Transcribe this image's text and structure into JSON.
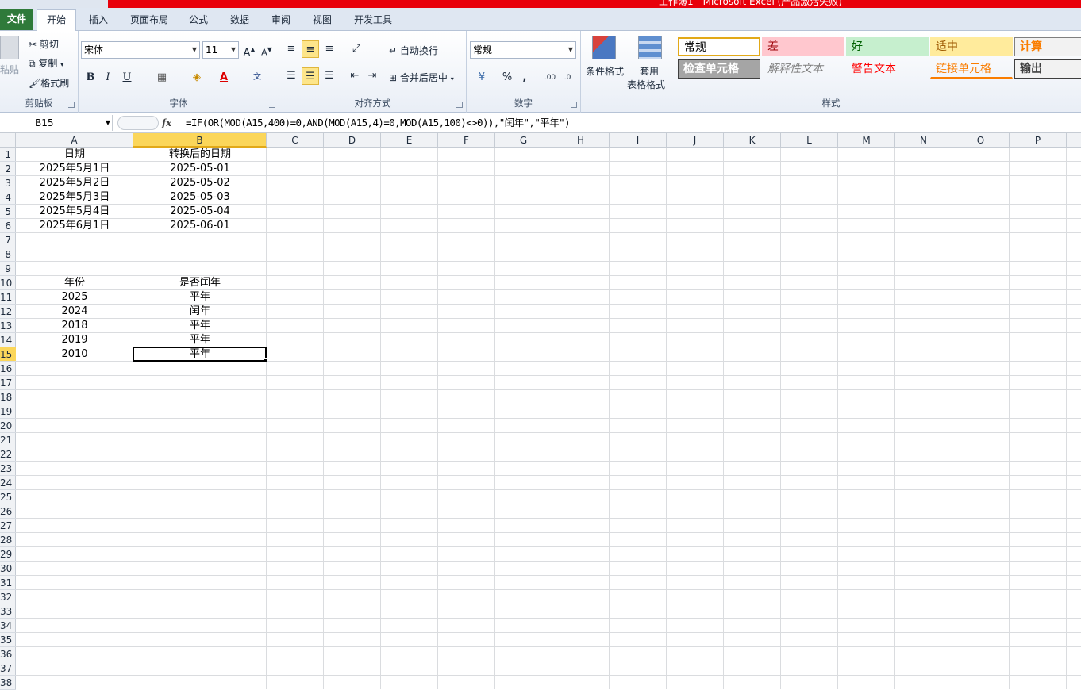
{
  "window": {
    "title": "工作簿1 - Microsoft Excel (产品激活失败)"
  },
  "tabs": [
    "文件",
    "开始",
    "插入",
    "页面布局",
    "公式",
    "数据",
    "审阅",
    "视图",
    "开发工具"
  ],
  "clipboard": {
    "paste": "粘贴",
    "cut": "剪切",
    "copy": "复制",
    "format_painter": "格式刷",
    "group": "剪贴板"
  },
  "font": {
    "name": "宋体",
    "size": "11",
    "bold": "B",
    "italic": "I",
    "underline": "U",
    "group": "字体"
  },
  "alignment": {
    "wrap": "自动换行",
    "merge": "合并后居中",
    "group": "对齐方式"
  },
  "number": {
    "format": "常规",
    "percent": "%",
    "comma": ",",
    "group": "数字"
  },
  "styles": {
    "conditional": "条件格式",
    "table_l1": "套用",
    "table_l2": "表格格式",
    "group": "样式",
    "cells": [
      {
        "label": "常规",
        "bg": "#ffffff",
        "fg": "#000000",
        "border": "#e2a918"
      },
      {
        "label": "差",
        "bg": "#ffc7ce",
        "fg": "#9c0006",
        "border": "transparent"
      },
      {
        "label": "好",
        "bg": "#c6efce",
        "fg": "#006100",
        "border": "transparent"
      },
      {
        "label": "适中",
        "bg": "#ffeb9c",
        "fg": "#9c5700",
        "border": "transparent"
      },
      {
        "label": "计算",
        "bg": "#f2f2f2",
        "fg": "#fa7d00",
        "border": "#7f7f7f"
      },
      {
        "label": "检查单元格",
        "bg": "#a5a5a5",
        "fg": "#ffffff",
        "border": "#3f3f3f"
      },
      {
        "label": "解释性文本",
        "bg": "transparent",
        "fg": "#7f7f7f",
        "border": "transparent"
      },
      {
        "label": "警告文本",
        "bg": "transparent",
        "fg": "#ff0000",
        "border": "transparent"
      },
      {
        "label": "链接单元格",
        "bg": "transparent",
        "fg": "#fa7d00",
        "border": "transparent"
      },
      {
        "label": "输出",
        "bg": "#f2f2f2",
        "fg": "#3f3f3f",
        "border": "#3f3f3f"
      }
    ]
  },
  "formula_bar": {
    "name_box": "B15",
    "fx": "fx",
    "formula": "=IF(OR(MOD(A15,400)=0,AND(MOD(A15,4)=0,MOD(A15,100)<>0)),\"闰年\",\"平年\")"
  },
  "columns": [
    "A",
    "B",
    "C",
    "D",
    "E",
    "F",
    "G",
    "H",
    "I",
    "J",
    "K",
    "L",
    "M",
    "N",
    "O",
    "P"
  ],
  "rows": [
    "1",
    "2",
    "3",
    "4",
    "5",
    "6",
    "7",
    "8",
    "9",
    "10",
    "11",
    "12",
    "13",
    "14",
    "15",
    "16",
    "17",
    "18",
    "19",
    "20",
    "21",
    "22",
    "23",
    "24",
    "25",
    "26",
    "27",
    "28",
    "29",
    "30",
    "31",
    "32",
    "33",
    "34",
    "35",
    "36",
    "37",
    "38"
  ],
  "cells": [
    {
      "ref": "A1",
      "value": "日期"
    },
    {
      "ref": "B1",
      "value": "转换后的日期"
    },
    {
      "ref": "A2",
      "value": "2025年5月1日"
    },
    {
      "ref": "B2",
      "value": "2025-05-01"
    },
    {
      "ref": "A3",
      "value": "2025年5月2日"
    },
    {
      "ref": "B3",
      "value": "2025-05-02"
    },
    {
      "ref": "A4",
      "value": "2025年5月3日"
    },
    {
      "ref": "B4",
      "value": "2025-05-03"
    },
    {
      "ref": "A5",
      "value": "2025年5月4日"
    },
    {
      "ref": "B5",
      "value": "2025-05-04"
    },
    {
      "ref": "A6",
      "value": "2025年6月1日"
    },
    {
      "ref": "B6",
      "value": "2025-06-01"
    },
    {
      "ref": "A10",
      "value": "年份"
    },
    {
      "ref": "B10",
      "value": "是否闰年"
    },
    {
      "ref": "A11",
      "value": "2025"
    },
    {
      "ref": "B11",
      "value": "平年"
    },
    {
      "ref": "A12",
      "value": "2024"
    },
    {
      "ref": "B12",
      "value": "闰年"
    },
    {
      "ref": "A13",
      "value": "2018"
    },
    {
      "ref": "B13",
      "value": "平年"
    },
    {
      "ref": "A14",
      "value": "2019"
    },
    {
      "ref": "B14",
      "value": "平年"
    },
    {
      "ref": "A15",
      "value": "2010"
    },
    {
      "ref": "B15",
      "value": "平年"
    }
  ],
  "selected": {
    "col": "B",
    "row": "15"
  }
}
